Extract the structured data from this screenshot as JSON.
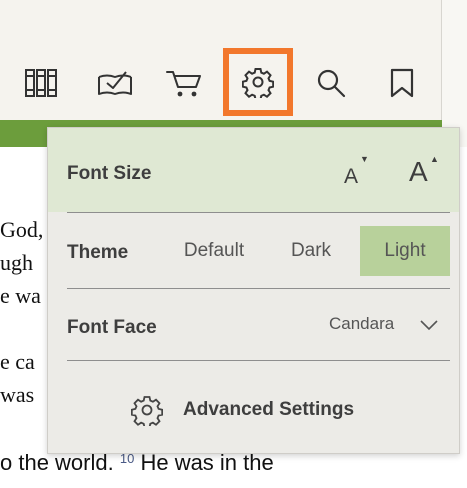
{
  "toolbar": {
    "items": [
      {
        "icon": "library-icon"
      },
      {
        "icon": "book-check-icon"
      },
      {
        "icon": "cart-icon"
      },
      {
        "icon": "gear-icon",
        "highlight_color": "#f2772c"
      },
      {
        "icon": "search-icon"
      },
      {
        "icon": "bookmark-icon"
      }
    ]
  },
  "reading": {
    "lines": [
      "God,",
      "ugh",
      "e wa",
      "",
      "e ca",
      "was",
      ""
    ],
    "bottom_text": "o the world.",
    "bottom_verse": "10",
    "bottom_text_after": "He was in the"
  },
  "settings": {
    "font_size": {
      "label": "Font Size",
      "decrease": "A",
      "increase": "A"
    },
    "theme": {
      "label": "Theme",
      "options": [
        "Default",
        "Dark",
        "Light"
      ],
      "selected": "Light"
    },
    "font_face": {
      "label": "Font Face",
      "value": "Candara"
    },
    "advanced": {
      "label": "Advanced Settings"
    }
  },
  "colors": {
    "accent_green": "#6c9d3c",
    "selected_theme": "#b8d19b",
    "highlight": "#f2772c"
  }
}
